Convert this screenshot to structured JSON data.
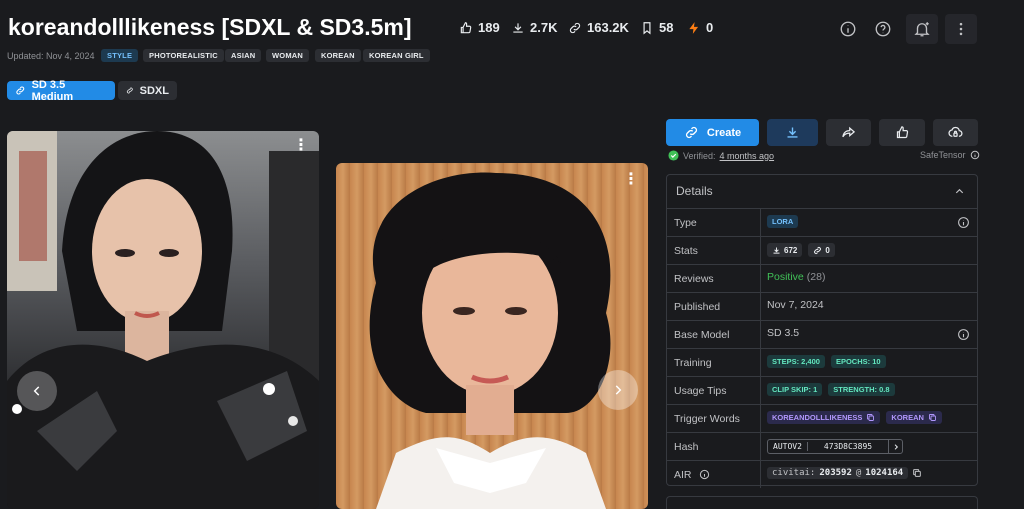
{
  "header": {
    "title": "koreandolllikeness [SDXL & SD3.5m]",
    "stats": {
      "likes": "189",
      "downloads": "2.7K",
      "generations": "163.2K",
      "bookmarks": "58",
      "buzz": "0"
    },
    "updated": "Updated: Nov 4, 2024",
    "tags": [
      "STYLE",
      "PHOTOREALISTIC",
      "ASIAN",
      "WOMAN",
      "KOREAN",
      "KOREAN GIRL"
    ]
  },
  "versions": [
    "SD 3.5 Medium",
    "SDXL"
  ],
  "actions": {
    "create": "Create"
  },
  "verified": {
    "label": "Verified:",
    "time": "4 months ago",
    "format": "SafeTensor"
  },
  "details": {
    "title": "Details",
    "rows": {
      "type": {
        "label": "Type",
        "value": "LORA"
      },
      "stats": {
        "label": "Stats",
        "downloads": "672",
        "generations": "0"
      },
      "reviews": {
        "label": "Reviews",
        "value": "Positive",
        "count": "(28)"
      },
      "published": {
        "label": "Published",
        "value": "Nov 7, 2024"
      },
      "base_model": {
        "label": "Base Model",
        "value": "SD 3.5"
      },
      "training": {
        "label": "Training",
        "steps": "STEPS: 2,400",
        "epochs": "EPOCHS: 10"
      },
      "usage_tips": {
        "label": "Usage Tips",
        "clip_skip": "CLIP SKIP: 1",
        "strength": "STRENGTH: 0.8"
      },
      "trigger_words": {
        "label": "Trigger Words",
        "words": [
          "KOREANDOLLLIKENESS",
          "KOREAN"
        ]
      },
      "hash": {
        "label": "Hash",
        "algo": "AUTOV2",
        "value": "473D8C3895"
      },
      "air": {
        "label": "AIR",
        "prefix": "civitai:",
        "model": "203592",
        "at": "@",
        "version": "1024164"
      }
    }
  },
  "colors": {
    "accent": "#228be6",
    "background": "#1a1b1e",
    "positive": "#40c057"
  }
}
